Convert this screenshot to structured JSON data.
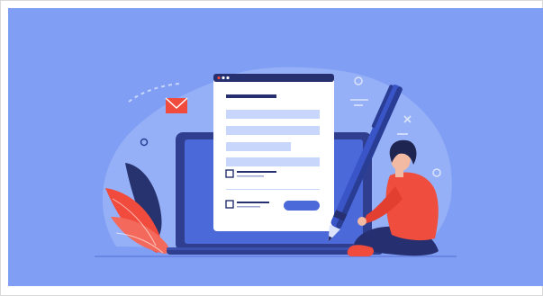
{
  "scene": {
    "description_role": "illustration",
    "colors": {
      "background": "#7f9ef4",
      "blob": "#9ab3f7",
      "laptop_screen": "#4b69d8",
      "laptop_frame": "#2f3e8f",
      "form_card": "#ffffff",
      "form_field": "#c9d6fb",
      "form_button": "#4b69d8",
      "pen_body": "#3a55c8",
      "pen_dark": "#2a3d94",
      "person_shirt": "#ef4d3e",
      "person_pants": "#263070",
      "person_hair": "#1e2550",
      "skin": "#f2b9a3",
      "leaf_red": "#f04b3c",
      "leaf_dark": "#27336f",
      "envelope": "#f04b3c"
    },
    "icons": [
      "envelope-icon",
      "pen-icon",
      "checkbox-icon",
      "close-x-icon",
      "circle-icon",
      "leaf-icon"
    ]
  }
}
